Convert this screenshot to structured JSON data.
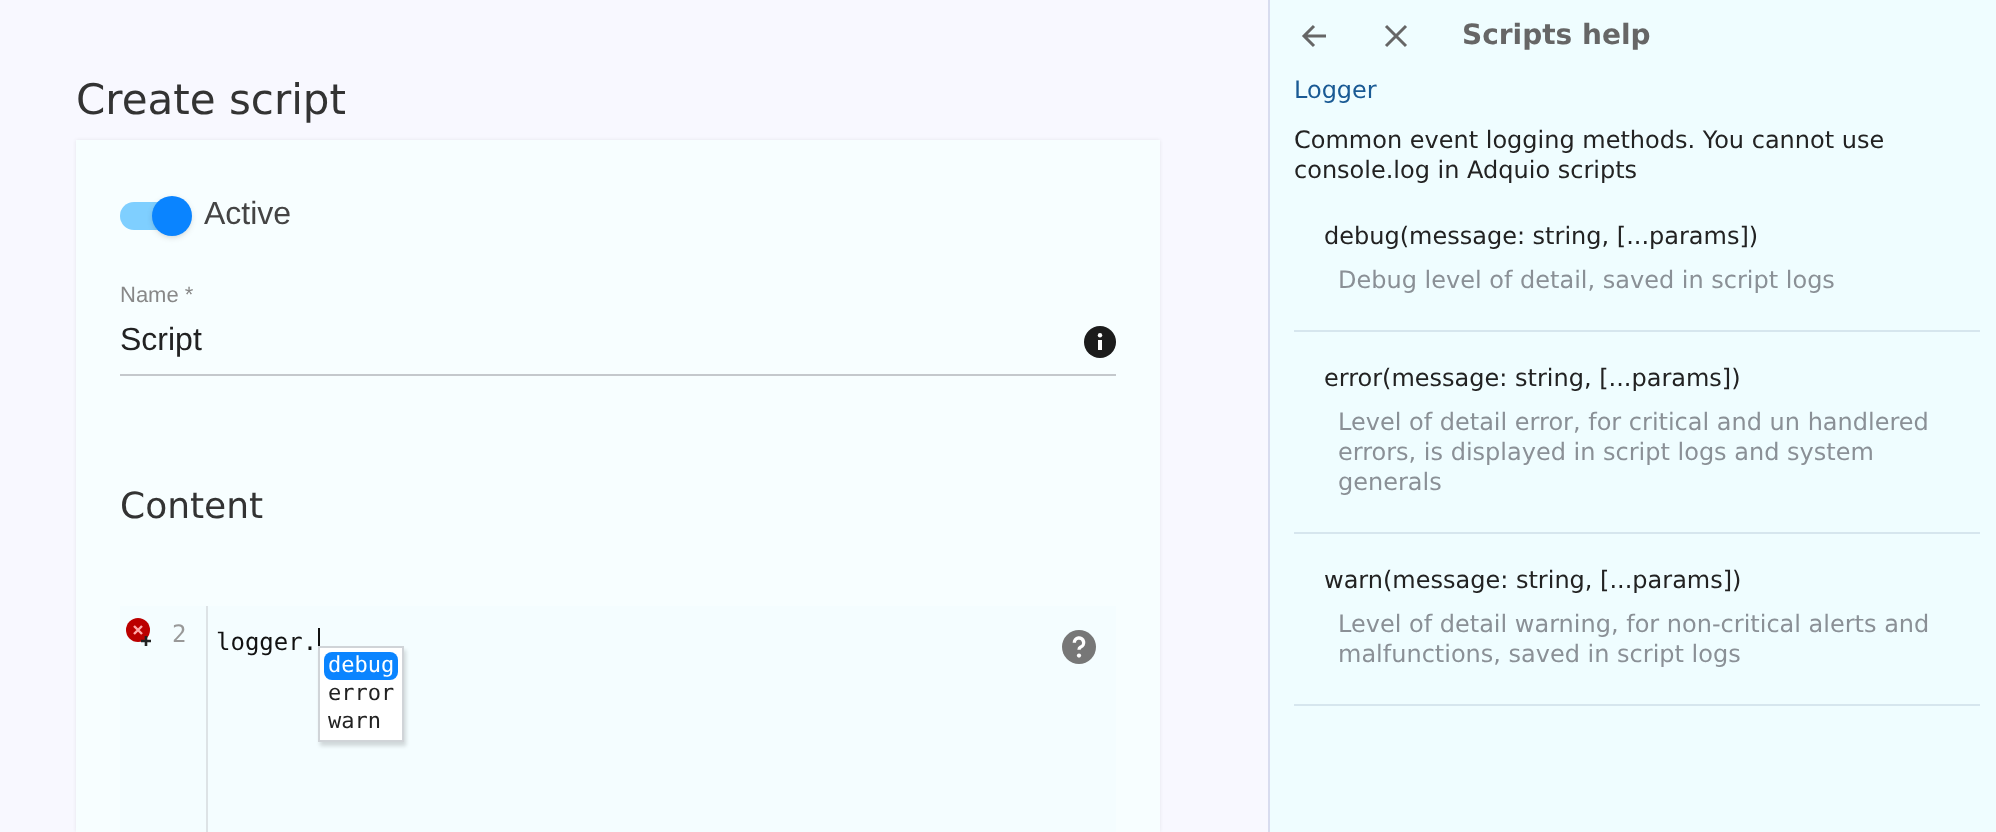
{
  "page": {
    "title": "Create script"
  },
  "active_toggle": {
    "label": "Active",
    "on": true
  },
  "name_field": {
    "label": "Name *",
    "value": "Script"
  },
  "content": {
    "heading": "Content"
  },
  "editor": {
    "line_number": "2",
    "code": "logger.",
    "has_error": true,
    "suggestions": [
      {
        "label": "debug",
        "selected": true
      },
      {
        "label": "error",
        "selected": false
      },
      {
        "label": "warn",
        "selected": false
      }
    ]
  },
  "help_panel": {
    "title": "Scripts help",
    "section": "Logger",
    "description": "Common event logging methods. You cannot use console.log in Adquio scripts",
    "methods": [
      {
        "signature": "debug(message: string, [...params])",
        "description": "Debug level of detail, saved in script logs"
      },
      {
        "signature": "error(message: string, [...params])",
        "description": "Level of detail error, for critical and un handlered errors, is displayed in script logs and system generals"
      },
      {
        "signature": "warn(message: string, [...params])",
        "description": "Level of detail warning, for non-critical alerts and malfunctions, saved in script logs"
      }
    ]
  }
}
